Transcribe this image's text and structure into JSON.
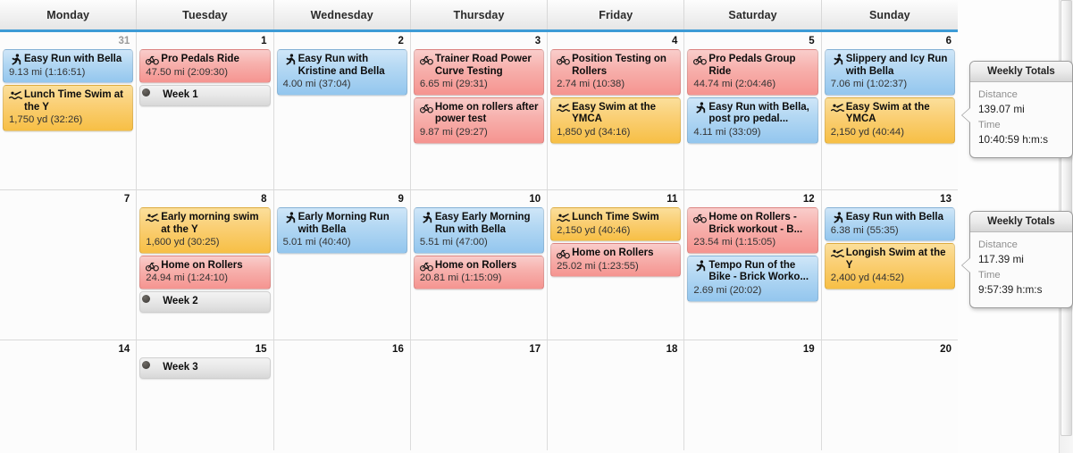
{
  "calendar": {
    "daynames": [
      "Monday",
      "Tuesday",
      "Wednesday",
      "Thursday",
      "Friday",
      "Saturday",
      "Sunday"
    ],
    "weeks": [
      {
        "days": [
          {
            "num": "31",
            "other_month": true,
            "events": [
              {
                "icon": "runner-icon",
                "sport": "run",
                "title": "Easy Run with Bella",
                "sub": "9.13 mi (1:16:51)"
              },
              {
                "icon": "swimmer-icon",
                "sport": "swim",
                "title": "Lunch Time Swim at the Y",
                "sub": "1,750 yd (32:26)"
              }
            ]
          },
          {
            "num": "1",
            "other_month": false,
            "events": [
              {
                "icon": "bike-icon",
                "sport": "ride",
                "title": "Pro Pedals Ride",
                "sub": "47.50 mi (2:09:30)"
              },
              {
                "icon": "bullet-icon",
                "sport": "note",
                "title": "Week 1",
                "sub": ""
              }
            ]
          },
          {
            "num": "2",
            "other_month": false,
            "events": [
              {
                "icon": "runner-icon",
                "sport": "run",
                "title": "Easy Run with Kristine and Bella",
                "sub": "4.00 mi (37:04)"
              }
            ]
          },
          {
            "num": "3",
            "other_month": false,
            "events": [
              {
                "icon": "bike-icon",
                "sport": "ride",
                "title": "Trainer Road Power Curve Testing",
                "sub": "6.65 mi (29:31)"
              },
              {
                "icon": "bike-icon",
                "sport": "ride",
                "title": "Home on rollers after power test",
                "sub": "9.87 mi (29:27)"
              }
            ]
          },
          {
            "num": "4",
            "other_month": false,
            "events": [
              {
                "icon": "bike-icon",
                "sport": "ride",
                "title": "Position Testing on Rollers",
                "sub": "2.74 mi (10:38)"
              },
              {
                "icon": "swimmer-icon",
                "sport": "swim",
                "title": "Easy Swim at the YMCA",
                "sub": "1,850 yd (34:16)"
              }
            ]
          },
          {
            "num": "5",
            "other_month": false,
            "events": [
              {
                "icon": "bike-icon",
                "sport": "ride",
                "title": "Pro Pedals Group Ride",
                "sub": "44.74 mi (2:04:46)"
              },
              {
                "icon": "runner-icon",
                "sport": "run",
                "title": "Easy Run with Bella, post pro pedal...",
                "sub": "4.11 mi (33:09)"
              }
            ]
          },
          {
            "num": "6",
            "other_month": false,
            "events": [
              {
                "icon": "runner-icon",
                "sport": "run",
                "title": "Slippery and Icy Run with Bella",
                "sub": "7.06 mi (1:02:37)"
              },
              {
                "icon": "swimmer-icon",
                "sport": "swim",
                "title": "Easy Swim at the YMCA",
                "sub": "2,150 yd (40:44)"
              }
            ]
          }
        ]
      },
      {
        "days": [
          {
            "num": "7",
            "other_month": false,
            "events": []
          },
          {
            "num": "8",
            "other_month": false,
            "events": [
              {
                "icon": "swimmer-icon",
                "sport": "swim",
                "title": "Early morning swim at the Y",
                "sub": "1,600 yd (30:25)"
              },
              {
                "icon": "bike-icon",
                "sport": "ride",
                "title": "Home on Rollers",
                "sub": "24.94 mi (1:24:10)"
              },
              {
                "icon": "bullet-icon",
                "sport": "note",
                "title": "Week 2",
                "sub": ""
              }
            ]
          },
          {
            "num": "9",
            "other_month": false,
            "events": [
              {
                "icon": "runner-icon",
                "sport": "run",
                "title": "Early Morning Run with Bella",
                "sub": "5.01 mi (40:40)"
              }
            ]
          },
          {
            "num": "10",
            "other_month": false,
            "events": [
              {
                "icon": "runner-icon",
                "sport": "run",
                "title": "Easy Early Morning Run with Bella",
                "sub": "5.51 mi (47:00)"
              },
              {
                "icon": "bike-icon",
                "sport": "ride",
                "title": "Home on Rollers",
                "sub": "20.81 mi (1:15:09)"
              }
            ]
          },
          {
            "num": "11",
            "other_month": false,
            "events": [
              {
                "icon": "swimmer-icon",
                "sport": "swim",
                "title": "Lunch Time Swim",
                "sub": "2,150 yd (40:46)"
              },
              {
                "icon": "bike-icon",
                "sport": "ride",
                "title": "Home on Rollers",
                "sub": "25.02 mi (1:23:55)"
              }
            ]
          },
          {
            "num": "12",
            "other_month": false,
            "events": [
              {
                "icon": "bike-icon",
                "sport": "ride",
                "title": "Home on Rollers - Brick workout - B...",
                "sub": "23.54 mi (1:15:05)"
              },
              {
                "icon": "runner-icon",
                "sport": "run",
                "title": "Tempo Run of the Bike - Brick Worko...",
                "sub": "2.69 mi (20:02)"
              }
            ]
          },
          {
            "num": "13",
            "other_month": false,
            "events": [
              {
                "icon": "runner-icon",
                "sport": "run",
                "title": "Easy Run with Bella",
                "sub": "6.38 mi (55:35)"
              },
              {
                "icon": "swimmer-icon",
                "sport": "swim",
                "title": "Longish Swim at the Y",
                "sub": "2,400 yd (44:52)"
              }
            ]
          }
        ]
      },
      {
        "days": [
          {
            "num": "14",
            "other_month": false,
            "events": []
          },
          {
            "num": "15",
            "other_month": false,
            "events": [
              {
                "icon": "bullet-icon",
                "sport": "note",
                "title": "Week 3",
                "sub": ""
              }
            ]
          },
          {
            "num": "16",
            "other_month": false,
            "events": []
          },
          {
            "num": "17",
            "other_month": false,
            "events": []
          },
          {
            "num": "18",
            "other_month": false,
            "events": []
          },
          {
            "num": "19",
            "other_month": false,
            "events": []
          },
          {
            "num": "20",
            "other_month": false,
            "events": []
          }
        ]
      }
    ]
  },
  "weekly_totals": [
    {
      "heading": "Weekly Totals",
      "distance_label": "Distance",
      "distance_value": "139.07 mi",
      "time_label": "Time",
      "time_value": "10:40:59 h:m:s"
    },
    {
      "heading": "Weekly Totals",
      "distance_label": "Distance",
      "distance_value": "117.39 mi",
      "time_label": "Time",
      "time_value": "9:57:39 h:m:s"
    }
  ],
  "colors": {
    "header_accent": "#3d9bd6",
    "ride": "#f59490",
    "run": "#93c6ee",
    "swim": "#f7bf45",
    "note": "#d8d8d8"
  },
  "icons": {
    "runner-icon": "🏃",
    "bike-icon": "🚲",
    "swimmer-icon": "🏊",
    "bullet-icon": "●"
  }
}
